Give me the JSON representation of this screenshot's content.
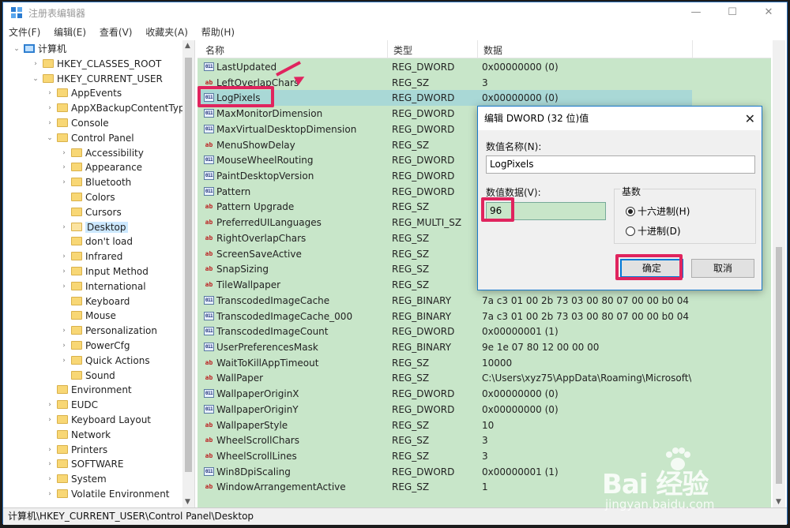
{
  "window": {
    "title": "注册表编辑器",
    "minimize": "—",
    "maximize": "☐",
    "close": "✕"
  },
  "menu": [
    "文件(F)",
    "编辑(E)",
    "查看(V)",
    "收藏夹(A)",
    "帮助(H)"
  ],
  "tree": [
    {
      "label": "计算机",
      "level": 0,
      "expander": "⌄",
      "icon": "computer-icon"
    },
    {
      "label": "HKEY_CLASSES_ROOT",
      "level": 1,
      "expander": "›"
    },
    {
      "label": "HKEY_CURRENT_USER",
      "level": 1,
      "expander": "⌄"
    },
    {
      "label": "AppEvents",
      "level": 2,
      "expander": "›"
    },
    {
      "label": "AppXBackupContentType",
      "level": 2,
      "expander": "›"
    },
    {
      "label": "Console",
      "level": 2,
      "expander": "›"
    },
    {
      "label": "Control Panel",
      "level": 2,
      "expander": "⌄"
    },
    {
      "label": "Accessibility",
      "level": 3,
      "expander": "›"
    },
    {
      "label": "Appearance",
      "level": 3,
      "expander": "›"
    },
    {
      "label": "Bluetooth",
      "level": 3,
      "expander": "›"
    },
    {
      "label": "Colors",
      "level": 3,
      "expander": ""
    },
    {
      "label": "Cursors",
      "level": 3,
      "expander": ""
    },
    {
      "label": "Desktop",
      "level": 3,
      "expander": "›",
      "selected": true
    },
    {
      "label": "don't load",
      "level": 3,
      "expander": ""
    },
    {
      "label": "Infrared",
      "level": 3,
      "expander": "›"
    },
    {
      "label": "Input Method",
      "level": 3,
      "expander": "›"
    },
    {
      "label": "International",
      "level": 3,
      "expander": "›"
    },
    {
      "label": "Keyboard",
      "level": 3,
      "expander": ""
    },
    {
      "label": "Mouse",
      "level": 3,
      "expander": ""
    },
    {
      "label": "Personalization",
      "level": 3,
      "expander": "›"
    },
    {
      "label": "PowerCfg",
      "level": 3,
      "expander": "›"
    },
    {
      "label": "Quick Actions",
      "level": 3,
      "expander": "›"
    },
    {
      "label": "Sound",
      "level": 3,
      "expander": ""
    },
    {
      "label": "Environment",
      "level": 2,
      "expander": ""
    },
    {
      "label": "EUDC",
      "level": 2,
      "expander": "›"
    },
    {
      "label": "Keyboard Layout",
      "level": 2,
      "expander": "›"
    },
    {
      "label": "Network",
      "level": 2,
      "expander": ""
    },
    {
      "label": "Printers",
      "level": 2,
      "expander": "›"
    },
    {
      "label": "SOFTWARE",
      "level": 2,
      "expander": "›"
    },
    {
      "label": "System",
      "level": 2,
      "expander": "›"
    },
    {
      "label": "Volatile Environment",
      "level": 2,
      "expander": "›"
    }
  ],
  "columns": {
    "name": "名称",
    "type": "类型",
    "data": "数据"
  },
  "values": [
    {
      "name": "LastUpdated",
      "type": "REG_DWORD",
      "data": "0x00000000 (0)",
      "kind": "bin"
    },
    {
      "name": "LeftOverlapChars",
      "type": "REG_SZ",
      "data": "3",
      "kind": "str"
    },
    {
      "name": "LogPixels",
      "type": "REG_DWORD",
      "data": "0x00000000 (0)",
      "kind": "bin",
      "selected": true
    },
    {
      "name": "MaxMonitorDimension",
      "type": "REG_DWORD",
      "data": "",
      "kind": "bin"
    },
    {
      "name": "MaxVirtualDesktopDimension",
      "type": "REG_DWORD",
      "data": "",
      "kind": "bin"
    },
    {
      "name": "MenuShowDelay",
      "type": "REG_SZ",
      "data": "",
      "kind": "str"
    },
    {
      "name": "MouseWheelRouting",
      "type": "REG_DWORD",
      "data": "",
      "kind": "bin"
    },
    {
      "name": "PaintDesktopVersion",
      "type": "REG_DWORD",
      "data": "",
      "kind": "bin"
    },
    {
      "name": "Pattern",
      "type": "REG_DWORD",
      "data": "",
      "kind": "bin"
    },
    {
      "name": "Pattern Upgrade",
      "type": "REG_SZ",
      "data": "",
      "kind": "str"
    },
    {
      "name": "PreferredUILanguages",
      "type": "REG_MULTI_SZ",
      "data": "",
      "kind": "str"
    },
    {
      "name": "RightOverlapChars",
      "type": "REG_SZ",
      "data": "",
      "kind": "str"
    },
    {
      "name": "ScreenSaveActive",
      "type": "REG_SZ",
      "data": "",
      "kind": "str"
    },
    {
      "name": "SnapSizing",
      "type": "REG_SZ",
      "data": "",
      "kind": "str"
    },
    {
      "name": "TileWallpaper",
      "type": "REG_SZ",
      "data": "",
      "kind": "str"
    },
    {
      "name": "TranscodedImageCache",
      "type": "REG_BINARY",
      "data": "7a c3 01 00 2b 73 03 00 80 07 00 00 b0 04 0...",
      "kind": "bin"
    },
    {
      "name": "TranscodedImageCache_000",
      "type": "REG_BINARY",
      "data": "7a c3 01 00 2b 73 03 00 80 07 00 00 b0 04 0...",
      "kind": "bin"
    },
    {
      "name": "TranscodedImageCount",
      "type": "REG_DWORD",
      "data": "0x00000001 (1)",
      "kind": "bin"
    },
    {
      "name": "UserPreferencesMask",
      "type": "REG_BINARY",
      "data": "9e 1e 07 80 12 00 00 00",
      "kind": "bin"
    },
    {
      "name": "WaitToKillAppTimeout",
      "type": "REG_SZ",
      "data": "10000",
      "kind": "str"
    },
    {
      "name": "WallPaper",
      "type": "REG_SZ",
      "data": "C:\\Users\\xyz75\\AppData\\Roaming\\Microsoft\\...",
      "kind": "str"
    },
    {
      "name": "WallpaperOriginX",
      "type": "REG_DWORD",
      "data": "0x00000000 (0)",
      "kind": "bin"
    },
    {
      "name": "WallpaperOriginY",
      "type": "REG_DWORD",
      "data": "0x00000000 (0)",
      "kind": "bin"
    },
    {
      "name": "WallpaperStyle",
      "type": "REG_SZ",
      "data": "10",
      "kind": "str"
    },
    {
      "name": "WheelScrollChars",
      "type": "REG_SZ",
      "data": "3",
      "kind": "str"
    },
    {
      "name": "WheelScrollLines",
      "type": "REG_SZ",
      "data": "3",
      "kind": "str"
    },
    {
      "name": "Win8DpiScaling",
      "type": "REG_DWORD",
      "data": "0x00000001 (1)",
      "kind": "bin"
    },
    {
      "name": "WindowArrangementActive",
      "type": "REG_SZ",
      "data": "1",
      "kind": "str"
    }
  ],
  "icon_text": {
    "str": "ab",
    "bin": "011"
  },
  "statusbar": "计算机\\HKEY_CURRENT_USER\\Control Panel\\Desktop",
  "dialog": {
    "title": "编辑 DWORD (32 位)值",
    "close": "✕",
    "name_label": "数值名称(N):",
    "name_value": "LogPixels",
    "data_label": "数值数据(V):",
    "data_value": "96",
    "base_label": "基数",
    "hex_label": "十六进制(H)",
    "dec_label": "十进制(D)",
    "hex_selected": true,
    "ok": "确定",
    "cancel": "取消"
  },
  "watermark": {
    "brand": "Bai 经验",
    "url": "jingyan.baidu.com"
  },
  "colors": {
    "accent": "#0078d7",
    "highlight": "#e0245e",
    "list_bg": "#c8e6c9"
  }
}
